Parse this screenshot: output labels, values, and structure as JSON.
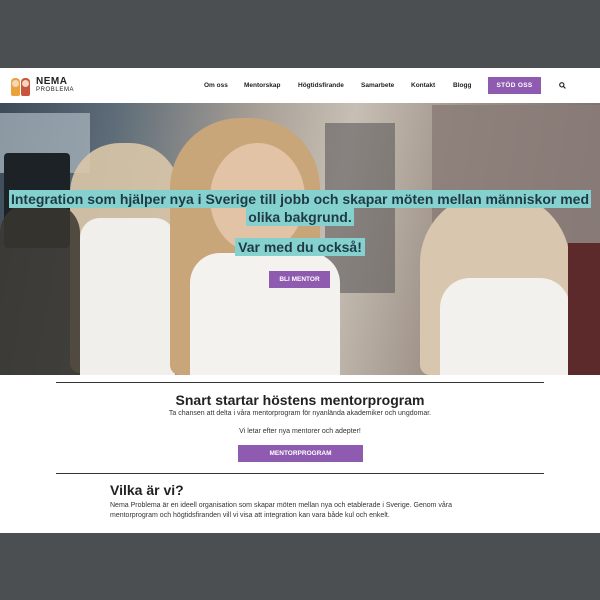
{
  "brand": {
    "name_line1": "NEMA",
    "name_line2": "PROBLEMA"
  },
  "nav": {
    "items": [
      "Om oss",
      "Mentorskap",
      "Högtidsfirande",
      "Samarbete",
      "Kontakt",
      "Blogg"
    ],
    "support_label": "STÖD OSS"
  },
  "hero": {
    "headline": "Integration som hjälper nya i Sverige till jobb och skapar möten mellan människor med olika bakgrund.",
    "subline": "Var med du också!",
    "button_label": "BLI MENTOR"
  },
  "mentor_section": {
    "title": "Snart startar höstens mentorprogram",
    "text1": "Ta chansen att delta i våra mentorprogram för nyanlända akademiker och ungdomar.",
    "text2": "Vi letar efter nya mentorer och adepter!",
    "button_label": "MENTORPROGRAM"
  },
  "about_section": {
    "title": "Vilka är vi?",
    "text": "Nema Problema är en ideell organisation som skapar möten mellan nya och etablerade i Sverige. Genom våra mentorprogram och högtidsfiranden vill vi visa att integration kan vara både kul och enkelt."
  },
  "colors": {
    "accent": "#8e5bb0",
    "highlight": "#85d1cf",
    "frame": "#4b4f52"
  }
}
